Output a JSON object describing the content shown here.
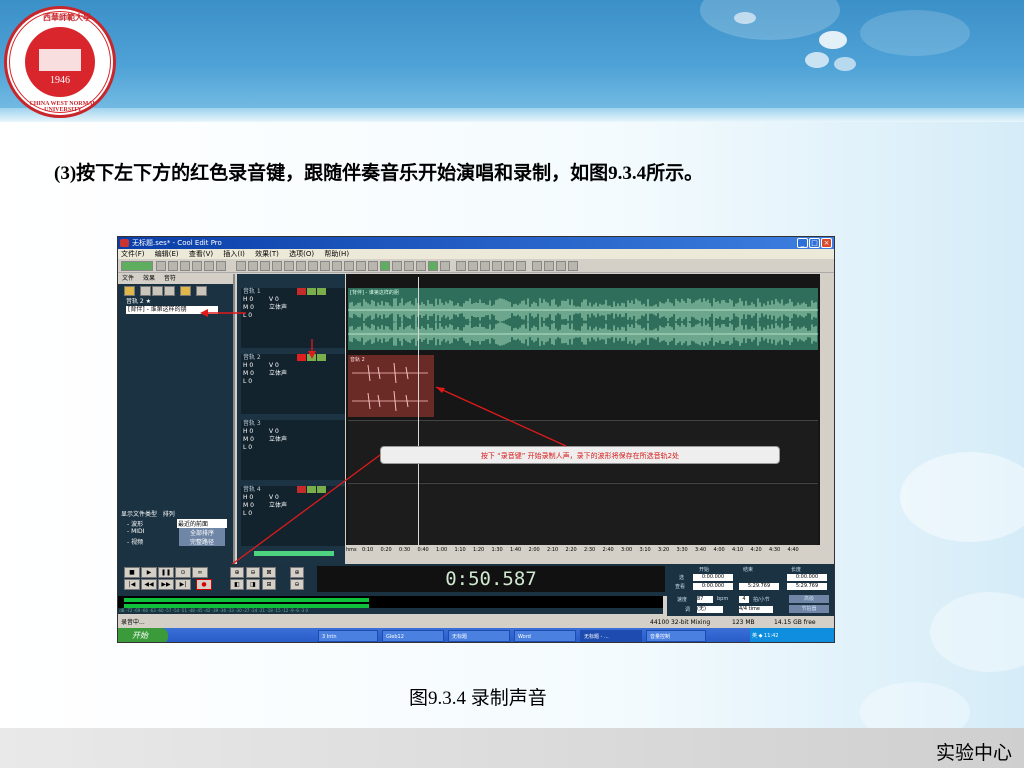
{
  "slide": {
    "instruction": "(3)按下左下方的红色录音键，跟随伴奏音乐开始演唱和录制，如图9.3.4所示。",
    "figure_caption": "图9.3.4 录制声音",
    "footer_label": "实验中心",
    "logo": {
      "year": "1946",
      "arc_text": "CHINA WEST NORMAL UNIVERSITY",
      "top_text": "西華師範大學"
    }
  },
  "app": {
    "title": "无标题.ses* - Cool Edit Pro",
    "menu": [
      "文件(F)",
      "编辑(E)",
      "查看(V)",
      "插入(I)",
      "效果(T)",
      "选项(O)",
      "帮助(H)"
    ],
    "left_tabs": [
      "文件",
      "效果",
      "音符"
    ],
    "files": [
      "音轨 2 ★",
      "[背伴] - 谁第这样的朋"
    ],
    "file_types_label": "显示文件类型",
    "sort_label": "排列",
    "file_types": [
      "- 波形",
      "- MIDI",
      "- 视频"
    ],
    "sort_value": "最近的前面",
    "sort_buttons": [
      "全部排序",
      "完整路径"
    ]
  },
  "tracks": [
    {
      "name": "音轨 1",
      "vol": "V 0",
      "pan": "立体声",
      "rows": [
        "H 0",
        "M 0",
        "L 0"
      ]
    },
    {
      "name": "音轨 2",
      "vol": "V 0",
      "pan": "立体声",
      "rows": [
        "H 0",
        "M 0",
        "L 0"
      ]
    },
    {
      "name": "音轨 3",
      "vol": "V 0",
      "pan": "立体声",
      "rows": [
        "H 0",
        "M 0",
        "L 0"
      ]
    },
    {
      "name": "音轨 4",
      "vol": "V 0",
      "pan": "立体声",
      "rows": [
        "H 0",
        "M 0",
        "L 0"
      ]
    }
  ],
  "callout_text": "按下 “录音键” 开始录制人声，录下的波形将保存在所选音轨2处",
  "ruler_labels": [
    "hms",
    "0:10",
    "0:20",
    "0:30",
    "0:40",
    "1:00",
    "1:10",
    "1:20",
    "1:30",
    "1:40",
    "2:00",
    "2:10",
    "2:20",
    "2:30",
    "2:40",
    "3:00",
    "3:10",
    "3:20",
    "3:30",
    "3:40",
    "4:00",
    "4:10",
    "4:20",
    "4:30",
    "4:40"
  ],
  "time_display": "0:50.587",
  "time_box": {
    "start_label": "开始",
    "end_label": "结束",
    "len_label": "长度",
    "sel": "选",
    "view": "查看",
    "values": [
      "0:00.000",
      "0:00.000",
      "0:00.000",
      "5:29.769",
      "5:29.769"
    ]
  },
  "tempo": {
    "label": "速度",
    "value": "87",
    "bpm": "bpm",
    "beats": "4",
    "per": "拍/小节",
    "advanced": "高级",
    "key_label": "调",
    "key_value": "(无)",
    "time_sig": "4/4 time",
    "metronome": "节拍器"
  },
  "status": {
    "left": "录音中...",
    "format": "44100 32-bit Mixing",
    "mem": "123 MB",
    "free": "14.15 GB free"
  },
  "taskbar": {
    "start": "开始",
    "tasks": [
      "3 Intn",
      "Gleb12",
      "无标题",
      "Word",
      "无标题 - ...",
      "音量控制"
    ],
    "tray": "英 ◆ 11:42"
  }
}
